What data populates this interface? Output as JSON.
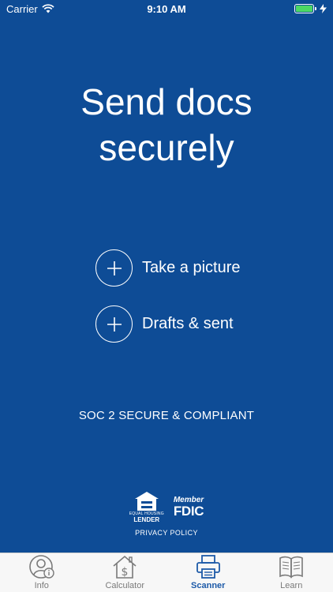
{
  "status_bar": {
    "carrier": "Carrier",
    "time": "9:10 AM",
    "battery_level": 1.0,
    "battery_color": "#4cd964"
  },
  "headline": {
    "line1": "Send docs",
    "line2": "securely"
  },
  "actions": [
    {
      "label": "Take a picture",
      "icon": "plus-circle-icon"
    },
    {
      "label": "Drafts & sent",
      "icon": "plus-circle-icon"
    }
  ],
  "security_note": "SOC 2 SECURE & COMPLIANT",
  "badges": {
    "ehl_small": "EQUAL HOUSING",
    "ehl_lender": "LENDER",
    "fdic_member": "Member",
    "fdic_name": "FDIC"
  },
  "privacy_link": "PRIVACY POLICY",
  "tab_bar": {
    "active_color": "#1d5aa8",
    "tabs": [
      {
        "label": "Info",
        "icon": "user-info-icon",
        "active": false
      },
      {
        "label": "Calculator",
        "icon": "house-dollar-icon",
        "active": false
      },
      {
        "label": "Scanner",
        "icon": "printer-icon",
        "active": true
      },
      {
        "label": "Learn",
        "icon": "open-book-icon",
        "active": false
      }
    ]
  },
  "colors": {
    "background": "#0e4c96",
    "tab_bar_background": "#f7f7f7",
    "inactive_tab": "#7a7a7a"
  }
}
